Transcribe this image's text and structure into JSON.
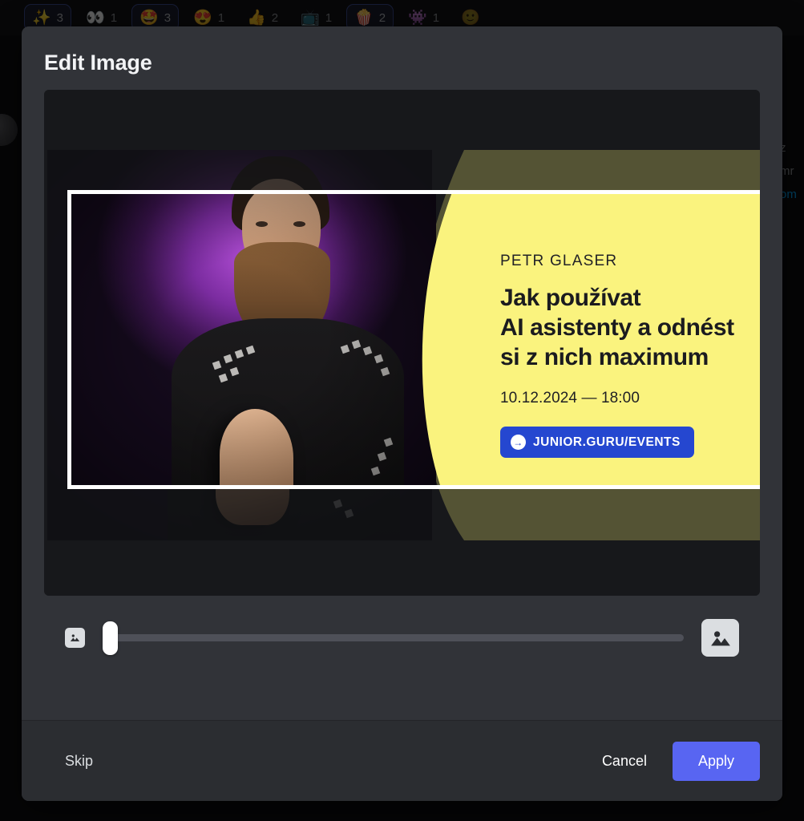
{
  "background": {
    "reactions": [
      {
        "emoji": "✨",
        "count": "3",
        "active": true,
        "name": "sparkles"
      },
      {
        "emoji": "👀",
        "count": "1",
        "active": false,
        "name": "eyes"
      },
      {
        "emoji": "🤩",
        "count": "3",
        "active": true,
        "name": "star-struck"
      },
      {
        "emoji": "😍",
        "count": "1",
        "active": false,
        "name": "heart-eyes"
      },
      {
        "emoji": "👍",
        "count": "2",
        "active": false,
        "name": "thumbs-up"
      },
      {
        "emoji": "📺",
        "count": "1",
        "active": false,
        "name": "television"
      },
      {
        "emoji": "🍿",
        "count": "2",
        "active": true,
        "name": "popcorn"
      },
      {
        "emoji": "👾",
        "count": "1",
        "active": false,
        "name": "alien-monster"
      }
    ],
    "add_reaction_icon": "🙂",
    "message_fragments": [
      "z",
      "mr",
      "om"
    ]
  },
  "modal": {
    "title": "Edit Image",
    "poster": {
      "speaker": "PETR GLASER",
      "title_line_1": "Jak používat",
      "title_line_2": "AI asistenty a odnést",
      "title_line_3": "si z nich maximum",
      "date": "10.12.2024 — 18:00",
      "cta_label": "JUNIOR.GURU/EVENTS",
      "cta_arrow": "→",
      "colors": {
        "panel_yellow": "#faf37e",
        "cta_blue": "#2547d0",
        "text_dark": "#16161a"
      }
    },
    "zoom_control": {
      "min_icon": "image-small-icon",
      "max_icon": "image-large-icon",
      "value": "0"
    },
    "footer": {
      "skip_label": "Skip",
      "cancel_label": "Cancel",
      "apply_label": "Apply",
      "apply_color": "#5865f2"
    }
  }
}
